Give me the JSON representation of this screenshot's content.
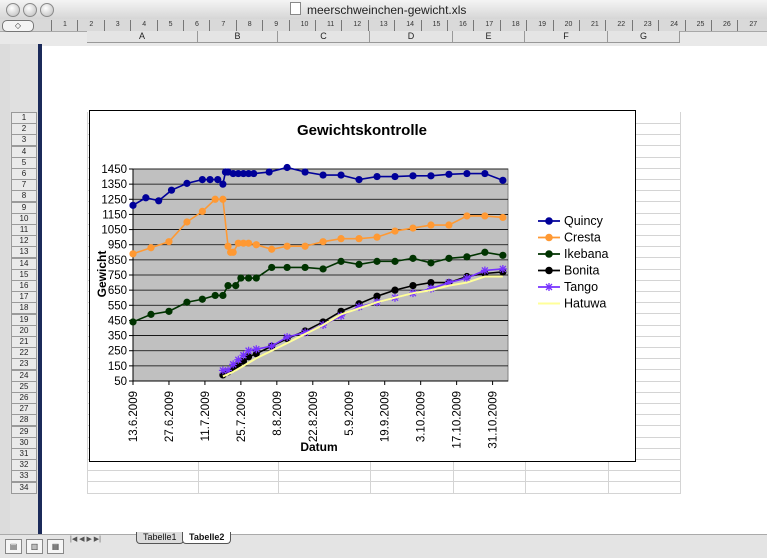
{
  "window": {
    "title": "meerschweinchen-gewicht.xls",
    "nav_glyph": "◇"
  },
  "ruler": [
    "1",
    "2",
    "3",
    "4",
    "5",
    "6",
    "7",
    "8",
    "9",
    "10",
    "11",
    "12",
    "13",
    "14",
    "15",
    "16",
    "17",
    "18",
    "19",
    "20",
    "21",
    "22",
    "23",
    "24",
    "25",
    "26",
    "27"
  ],
  "columns": [
    "A",
    "B",
    "C",
    "D",
    "E",
    "F",
    "G"
  ],
  "rows": [
    "1",
    "2",
    "3",
    "4",
    "5",
    "6",
    "7",
    "8",
    "9",
    "10",
    "11",
    "12",
    "13",
    "14",
    "15",
    "16",
    "17",
    "18",
    "19",
    "20",
    "21",
    "22",
    "23",
    "24",
    "25",
    "26",
    "27",
    "28",
    "29",
    "30",
    "31",
    "32",
    "33",
    "34"
  ],
  "sheets": {
    "nav": "|◀ ◀ ▶ ▶|",
    "tab1": "Tabelle1",
    "tab2": "Tabelle2",
    "active": "Tabelle2"
  },
  "view_buttons": [
    "normal-view-icon",
    "page-layout-view-icon",
    "page-break-view-icon"
  ],
  "chart_data": {
    "type": "line",
    "title": "Gewichtskontrolle",
    "xlabel": "Datum",
    "ylabel": "Gewicht",
    "ylim": [
      50,
      1450
    ],
    "yticks": [
      50,
      150,
      250,
      350,
      450,
      550,
      650,
      750,
      850,
      950,
      1050,
      1150,
      1250,
      1350,
      1450
    ],
    "xticks": [
      "13.6.2009",
      "27.6.2009",
      "11.7.2009",
      "25.7.2009",
      "8.8.2009",
      "22.8.2009",
      "5.9.2009",
      "19.9.2009",
      "3.10.2009",
      "17.10.2009",
      "31.10.2009"
    ],
    "xlim": [
      "2009-06-13",
      "2009-11-06"
    ],
    "plot_background": "#c0c0c0",
    "grid": true,
    "legend": "right",
    "series": [
      {
        "name": "Quincy",
        "color": "#000099",
        "marker": "circle",
        "x": [
          "2009-06-13",
          "2009-06-18",
          "2009-06-23",
          "2009-06-28",
          "2009-07-04",
          "2009-07-10",
          "2009-07-13",
          "2009-07-16",
          "2009-07-18",
          "2009-07-19",
          "2009-07-20",
          "2009-07-22",
          "2009-07-24",
          "2009-07-26",
          "2009-07-28",
          "2009-07-30",
          "2009-08-05",
          "2009-08-12",
          "2009-08-19",
          "2009-08-26",
          "2009-09-02",
          "2009-09-09",
          "2009-09-16",
          "2009-09-23",
          "2009-09-30",
          "2009-10-07",
          "2009-10-14",
          "2009-10-21",
          "2009-10-28",
          "2009-11-04"
        ],
        "y": [
          1210,
          1260,
          1240,
          1310,
          1355,
          1380,
          1380,
          1380,
          1350,
          1430,
          1430,
          1420,
          1420,
          1420,
          1420,
          1420,
          1430,
          1460,
          1430,
          1410,
          1410,
          1380,
          1400,
          1400,
          1405,
          1405,
          1415,
          1420,
          1420,
          1375
        ]
      },
      {
        "name": "Cresta",
        "color": "#ff9933",
        "marker": "circle",
        "x": [
          "2009-06-13",
          "2009-06-20",
          "2009-06-27",
          "2009-07-04",
          "2009-07-10",
          "2009-07-15",
          "2009-07-18",
          "2009-07-20",
          "2009-07-21",
          "2009-07-22",
          "2009-07-24",
          "2009-07-26",
          "2009-07-28",
          "2009-07-31",
          "2009-08-06",
          "2009-08-12",
          "2009-08-19",
          "2009-08-26",
          "2009-09-02",
          "2009-09-09",
          "2009-09-16",
          "2009-09-23",
          "2009-09-30",
          "2009-10-07",
          "2009-10-14",
          "2009-10-21",
          "2009-10-28",
          "2009-11-04"
        ],
        "y": [
          890,
          930,
          970,
          1100,
          1170,
          1250,
          1250,
          940,
          900,
          900,
          960,
          960,
          960,
          950,
          920,
          940,
          940,
          970,
          990,
          990,
          1000,
          1040,
          1060,
          1080,
          1080,
          1140,
          1140,
          1130
        ]
      },
      {
        "name": "Ikebana",
        "color": "#003300",
        "marker": "circle",
        "x": [
          "2009-06-13",
          "2009-06-20",
          "2009-06-27",
          "2009-07-04",
          "2009-07-10",
          "2009-07-15",
          "2009-07-18",
          "2009-07-20",
          "2009-07-23",
          "2009-07-25",
          "2009-07-28",
          "2009-07-31",
          "2009-08-06",
          "2009-08-12",
          "2009-08-19",
          "2009-08-26",
          "2009-09-02",
          "2009-09-09",
          "2009-09-16",
          "2009-09-23",
          "2009-09-30",
          "2009-10-07",
          "2009-10-14",
          "2009-10-21",
          "2009-10-28",
          "2009-11-04"
        ],
        "y": [
          440,
          490,
          510,
          570,
          590,
          615,
          615,
          680,
          680,
          730,
          730,
          730,
          800,
          800,
          800,
          790,
          840,
          820,
          840,
          840,
          860,
          830,
          860,
          870,
          900,
          880
        ]
      },
      {
        "name": "Bonita",
        "color": "#000000",
        "marker": "circle",
        "x": [
          "2009-07-18",
          "2009-07-20",
          "2009-07-22",
          "2009-07-24",
          "2009-07-26",
          "2009-07-28",
          "2009-07-31",
          "2009-08-06",
          "2009-08-12",
          "2009-08-19",
          "2009-08-26",
          "2009-09-02",
          "2009-09-09",
          "2009-09-16",
          "2009-09-23",
          "2009-09-30",
          "2009-10-07",
          "2009-10-14",
          "2009-10-21",
          "2009-10-28",
          "2009-11-04"
        ],
        "y": [
          90,
          110,
          130,
          150,
          180,
          210,
          230,
          280,
          330,
          380,
          440,
          510,
          560,
          610,
          650,
          680,
          700,
          700,
          740,
          760,
          770
        ]
      },
      {
        "name": "Tango",
        "color": "#7733ff",
        "marker": "asterisk",
        "x": [
          "2009-07-18",
          "2009-07-20",
          "2009-07-22",
          "2009-07-24",
          "2009-07-26",
          "2009-07-28",
          "2009-07-31",
          "2009-08-06",
          "2009-08-12",
          "2009-08-19",
          "2009-08-26",
          "2009-09-02",
          "2009-09-09",
          "2009-09-16",
          "2009-09-23",
          "2009-09-30",
          "2009-10-07",
          "2009-10-14",
          "2009-10-21",
          "2009-10-28",
          "2009-11-04"
        ],
        "y": [
          120,
          120,
          160,
          190,
          220,
          250,
          260,
          280,
          340,
          370,
          420,
          480,
          540,
          570,
          600,
          630,
          660,
          700,
          730,
          780,
          790
        ]
      },
      {
        "name": "Hatuwa",
        "color": "#ffff99",
        "marker": "none",
        "x": [
          "2009-07-18",
          "2009-07-22",
          "2009-07-26",
          "2009-07-31",
          "2009-08-06",
          "2009-08-12",
          "2009-08-19",
          "2009-08-26",
          "2009-09-02",
          "2009-09-09",
          "2009-09-16",
          "2009-09-23",
          "2009-09-30",
          "2009-10-07",
          "2009-10-14",
          "2009-10-21",
          "2009-10-28",
          "2009-11-04"
        ],
        "y": [
          80,
          110,
          150,
          200,
          250,
          300,
          360,
          420,
          490,
          530,
          570,
          600,
          630,
          650,
          680,
          700,
          740,
          740
        ]
      }
    ]
  }
}
